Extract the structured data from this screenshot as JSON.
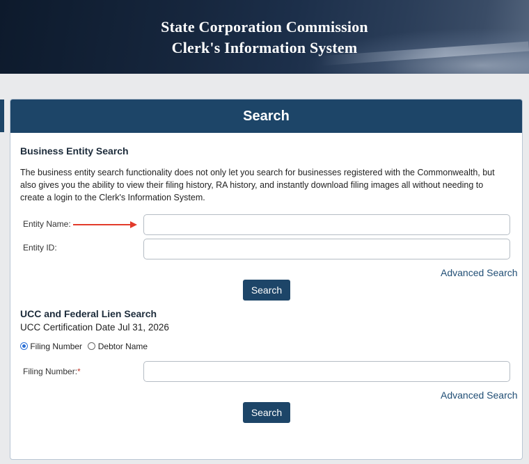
{
  "banner": {
    "line1": "State Corporation Commission",
    "line2": "Clerk's Information System"
  },
  "search_panel": {
    "title": "Search"
  },
  "business_search": {
    "title": "Business Entity Search",
    "description": "The business entity search functionality does not only let you search for businesses registered with the Commonwealth, but also gives you the ability to view their filing history, RA history, and instantly download filing images all without needing to create a login to the Clerk's Information System.",
    "entity_name_label": "Entity Name:",
    "entity_name_value": "",
    "entity_id_label": "Entity ID:",
    "entity_id_value": "",
    "advanced_link": "Advanced Search",
    "search_button": "Search"
  },
  "ucc_search": {
    "title": "UCC and Federal Lien Search",
    "certification": "UCC Certification Date Jul 31, 2026",
    "radio_options": [
      {
        "label": "Filing Number",
        "selected": true
      },
      {
        "label": "Debtor Name",
        "selected": false
      }
    ],
    "filing_number_label": "Filing Number:",
    "required_marker": "*",
    "filing_number_value": "",
    "advanced_link": "Advanced Search",
    "search_button": "Search"
  },
  "colors": {
    "header_blue": "#1d4568",
    "link_blue": "#1f4d74",
    "annotation_arrow": "#e23a2a",
    "required": "#c0392b"
  },
  "icons": {
    "annotation": "right-arrow-icon"
  }
}
